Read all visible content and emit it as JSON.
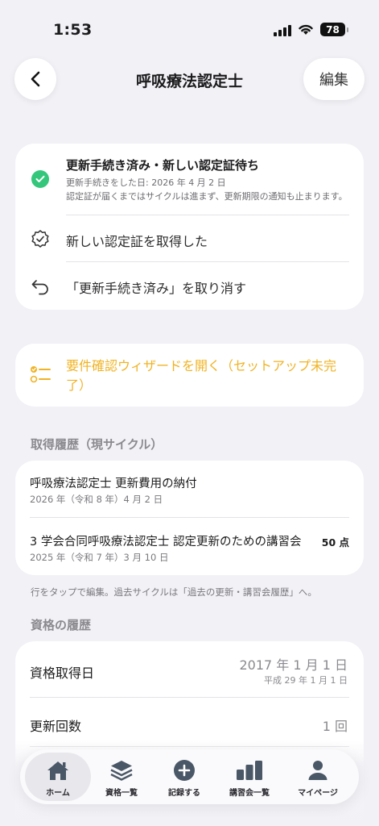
{
  "status_bar": {
    "time": "1:53",
    "battery": "78"
  },
  "nav": {
    "title": "呼吸療法認定士",
    "edit_label": "編集"
  },
  "status_card": {
    "title": "更新手続き済み・新しい認定証待ち",
    "sub1": "更新手続きをした日: 2026 年 4 月 2 日",
    "sub2": "認定証が届くまではサイクルは進まず、更新期限の通知も止まります。",
    "action_obtained": "新しい認定証を取得した",
    "action_undo": "「更新手続き済み」を取り消す"
  },
  "wizard": {
    "label": "要件確認ウィザードを開く（セットアップ未完了）"
  },
  "history_section": {
    "heading": "取得履歴（現サイクル）",
    "rows": [
      {
        "title": "呼吸療法認定士 更新費用の納付",
        "date": "2026 年（令和 8 年）4 月 2 日",
        "points": ""
      },
      {
        "title": "3 学会合同呼吸療法認定士 認定更新のための講習会",
        "date": "2025 年（令和 7 年）3 月 10 日",
        "points": "50 点"
      }
    ],
    "footnote": "行をタップで編集。過去サイクルは「過去の更新・講習会履歴」へ。"
  },
  "qualification_section": {
    "heading": "資格の履歴",
    "acquired_label": "資格取得日",
    "acquired_value": "2017 年 1 月 1 日",
    "acquired_sub": "平成 29 年 1 月 1 日",
    "renewals_label": "更新回数",
    "renewals_value": "1 回"
  },
  "tabbar": {
    "tabs": [
      {
        "label": "ホーム",
        "icon": "house-icon",
        "active": true
      },
      {
        "label": "資格一覧",
        "icon": "stack-icon",
        "active": false
      },
      {
        "label": "記録する",
        "icon": "plus-circle-icon",
        "active": false
      },
      {
        "label": "講習会一覧",
        "icon": "bar-chart-icon",
        "active": false
      },
      {
        "label": "マイページ",
        "icon": "person-icon",
        "active": false
      }
    ]
  },
  "colors": {
    "accent_green": "#34c77b",
    "wizard_yellow": "#f0b323",
    "background": "#f1f1f6"
  }
}
